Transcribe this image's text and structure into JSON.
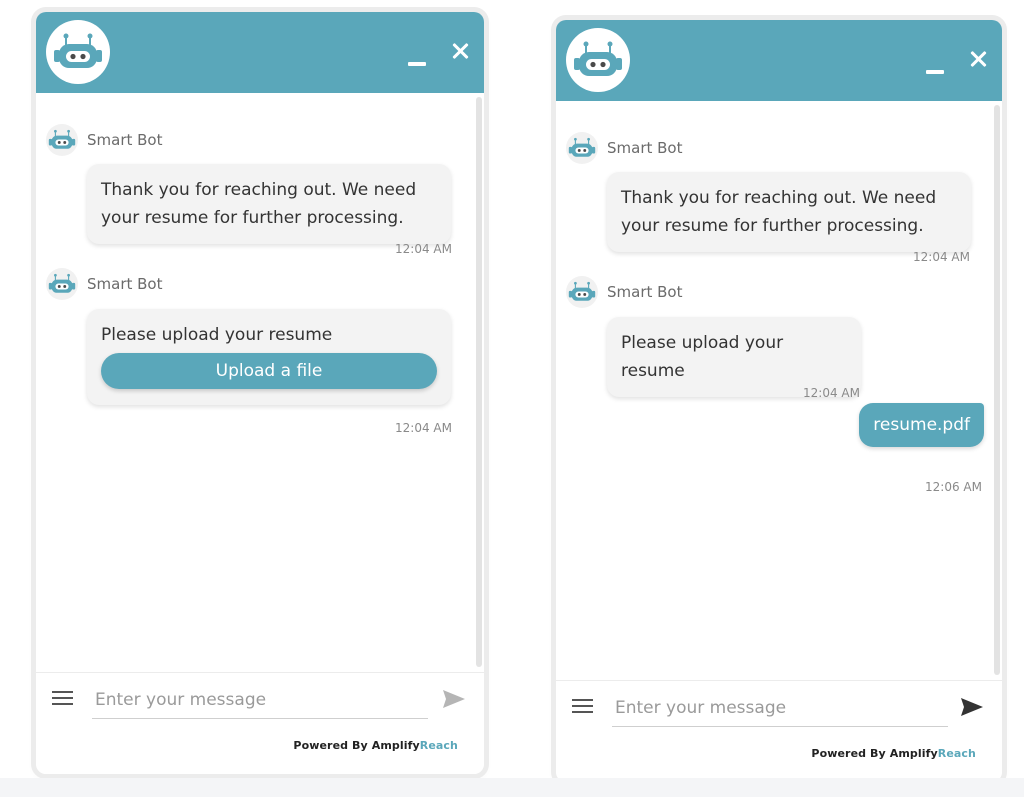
{
  "colors": {
    "accent": "#5aa7ba",
    "bubble_bg": "#f3f3f3",
    "footer_dark": "#222222"
  },
  "icons": {
    "header_avatar": "robot-icon",
    "minimize": "minimize-icon",
    "close": "close-icon",
    "menu": "hamburger-menu-icon",
    "send": "send-icon"
  },
  "widget1": {
    "messages": [
      {
        "sender": "Smart Bot",
        "text": "Thank you for reaching out. We need your resume for further processing.",
        "time": "12:04 AM"
      },
      {
        "sender": "Smart Bot",
        "text": "Please upload your resume",
        "button": "Upload a file",
        "time": "12:04 AM"
      }
    ],
    "composer": {
      "placeholder": "Enter your message"
    },
    "footer": {
      "powered_by": "Powered By",
      "brand_part1": "Amplify",
      "brand_part2": "Reach"
    }
  },
  "widget2": {
    "messages": [
      {
        "sender": "Smart Bot",
        "text": "Thank you for reaching out. We need your resume for further processing.",
        "time": "12:04 AM"
      },
      {
        "sender": "Smart Bot",
        "text": "Please upload your resume",
        "time": "12:04 AM"
      }
    ],
    "user_message": {
      "text": "resume.pdf",
      "time": "12:06 AM"
    },
    "composer": {
      "placeholder": "Enter your message"
    },
    "footer": {
      "powered_by": "Powered By",
      "brand_part1": "Amplify",
      "brand_part2": "Reach"
    }
  }
}
